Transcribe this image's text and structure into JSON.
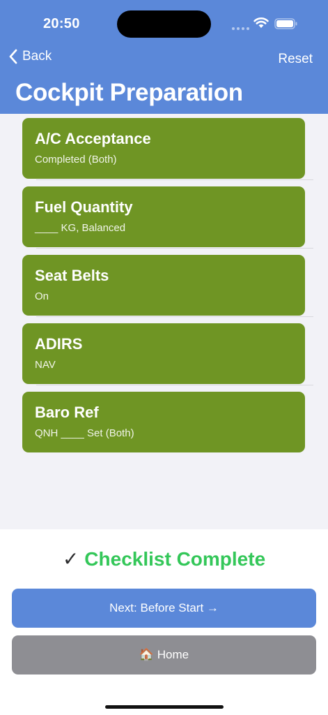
{
  "status_bar": {
    "time": "20:50"
  },
  "nav": {
    "back_label": "Back",
    "reset_label": "Reset",
    "title": "Cockpit Preparation"
  },
  "items": [
    {
      "title": "A/C Acceptance",
      "value": "Completed (Both)"
    },
    {
      "title": "Fuel Quantity",
      "value": "____ KG, Balanced"
    },
    {
      "title": "Seat Belts",
      "value": "On"
    },
    {
      "title": "ADIRS",
      "value": "NAV"
    },
    {
      "title": "Baro Ref",
      "value": "QNH ____ Set (Both)"
    }
  ],
  "footer": {
    "check_glyph": "✓",
    "complete_label": "Checklist Complete",
    "next_label": "Next: Before Start →",
    "home_label": "🏠 Home"
  },
  "colors": {
    "header": "#5b88d9",
    "item_bg": "#6f9524",
    "complete_green": "#34c759",
    "home_btn": "#8e8e93"
  },
  "icons": [
    "chevron-left-icon",
    "wifi-icon",
    "battery-icon",
    "cellular-signal-icon",
    "checkmark-icon",
    "house-icon"
  ]
}
